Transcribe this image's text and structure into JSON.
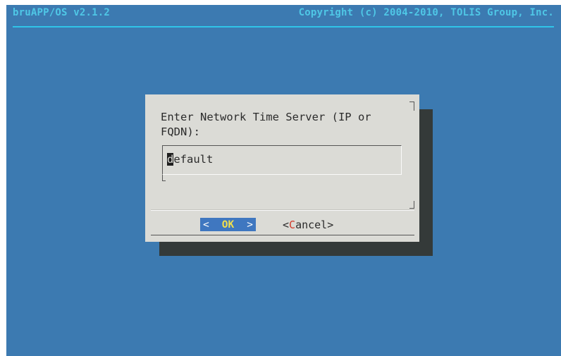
{
  "header": {
    "app_title": "bruAPP/OS v2.1.2",
    "copyright": "Copyright (c) 2004-2010, TOLIS Group, Inc."
  },
  "dialog": {
    "prompt": "Enter Network Time Server (IP or FQDN):",
    "input_value_first_char": "d",
    "input_value_rest": "efault",
    "ok_label": "OK",
    "ok_left_bracket": "<",
    "ok_right_bracket": ">",
    "cancel_open": "<",
    "cancel_hotkey": "C",
    "cancel_rest": "ancel",
    "cancel_close": ">"
  },
  "colors": {
    "background": "#3c7ab1",
    "title_text": "#4fc7e6",
    "dialog_bg": "#dbdbd6",
    "shadow": "#343a39",
    "ok_button_bg": "#3f77c0",
    "ok_label": "#f2df4c",
    "hotkey": "#d23a2a"
  }
}
